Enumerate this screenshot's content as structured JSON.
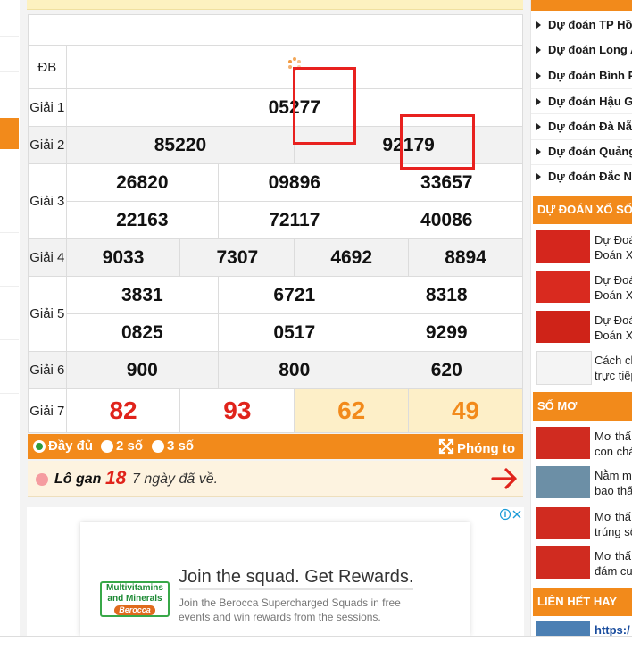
{
  "results": {
    "labels": {
      "db": "ĐB",
      "g1": "Giải 1",
      "g2": "Giải 2",
      "g3": "Giải 3",
      "g4": "Giải 4",
      "g5": "Giải 5",
      "g6": "Giải 6",
      "g7": "Giải 7"
    },
    "db": "",
    "g1": "05277",
    "g2": [
      "85220",
      "92179"
    ],
    "g3": [
      "26820",
      "09896",
      "33657",
      "22163",
      "72117",
      "40086"
    ],
    "g4": [
      "9033",
      "7307",
      "4692",
      "8894"
    ],
    "g5": [
      "3831",
      "6721",
      "8318",
      "0825",
      "0517",
      "9299"
    ],
    "g6": [
      "900",
      "800",
      "620"
    ],
    "g7": [
      "82",
      "93",
      "62",
      "49"
    ]
  },
  "options": {
    "full": "Đầy đủ",
    "two": "2 số",
    "three": "3 số",
    "zoom": "Phóng to"
  },
  "logan": {
    "label": "Lô gan",
    "count": "18",
    "text": "7 ngày đã về."
  },
  "ad": {
    "title": "Join the squad. Get Rewards.",
    "body_line1": "Join the Berocca Supercharged Squads in free",
    "body_line2": "events and win rewards from the sessions.",
    "brand_line1": "Multivitamins",
    "brand_line2": "and Minerals",
    "brand_logo": "Berocca"
  },
  "sidebar": {
    "links": [
      "Dự đoán TP Hồ",
      "Dự đoán Long A",
      "Dự đoán Bình P",
      "Dự đoán Hậu G",
      "Dự đoán Đà Nẵ",
      "Dự đoán Quảng",
      "Dự đoán Đắc N"
    ],
    "section1": "DỰ ĐOÁN XỔ SỐ",
    "section1_items": [
      {
        "l1": "Dự Đoá",
        "l2": "Đoán X"
      },
      {
        "l1": "Dự Đoá",
        "l2": "Đoán X"
      },
      {
        "l1": "Dự Đoá",
        "l2": "Đoán X"
      },
      {
        "l1": "Cách ch",
        "l2": "trực tiếp"
      }
    ],
    "section2": "SỐ MƠ",
    "section2_items": [
      {
        "l1": "Mơ thấ",
        "l2": "con chá"
      },
      {
        "l1": "Nằm m",
        "l2": "bao thấ"
      },
      {
        "l1": "Mơ thấ",
        "l2": "trúng số"
      },
      {
        "l1": "Mơ thấ",
        "l2": "đám cư"
      }
    ],
    "section3": "LIÊN HẾT HAY",
    "section3_link": "https:/"
  },
  "colors": {
    "accent": "#f28a1b",
    "red": "#e0231b",
    "highlight_box": "#e8211f"
  }
}
